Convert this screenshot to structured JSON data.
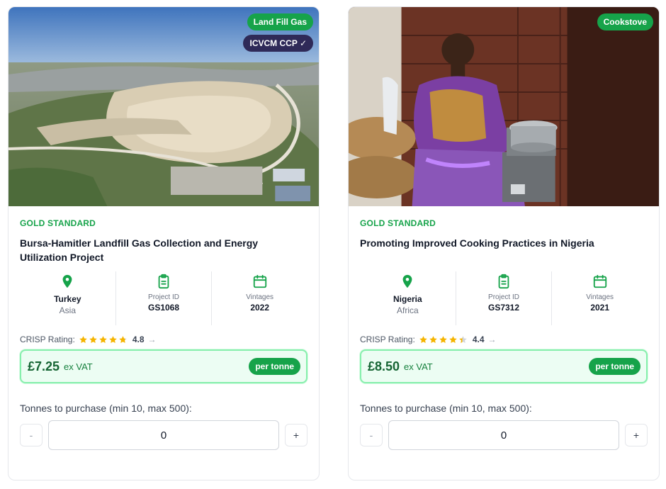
{
  "projects": [
    {
      "tags": [
        "Land Fill Gas",
        "ICVCM CCP ✓"
      ],
      "standard": "GOLD STANDARD",
      "title": "Bursa-Hamitler Landfill Gas Collection and Energy Utilization Project",
      "country": "Turkey",
      "region": "Asia",
      "project_id_label": "Project ID",
      "project_id": "GS1068",
      "vintages_label": "Vintages",
      "vintages": "2022",
      "rating_label": "CRISP Rating:",
      "rating_value": "4.8",
      "stars": 4.8,
      "rating_arrow": "→",
      "price": "£7.25",
      "vat": "ex VAT",
      "unit": "per tonne",
      "qty_label": "Tonnes to purchase (min 10, max 500):",
      "qty_value": "0",
      "minus": "-",
      "plus": "+"
    },
    {
      "tags": [
        "Cookstove"
      ],
      "standard": "GOLD STANDARD",
      "title": "Promoting Improved Cooking Practices in Nigeria",
      "country": "Nigeria",
      "region": "Africa",
      "project_id_label": "Project ID",
      "project_id": "GS7312",
      "vintages_label": "Vintages",
      "vintages": "2021",
      "rating_label": "CRISP Rating:",
      "rating_value": "4.4",
      "stars": 4.4,
      "rating_arrow": "→",
      "price": "£8.50",
      "vat": "ex VAT",
      "unit": "per tonne",
      "qty_label": "Tonnes to purchase (min 10, max 500):",
      "qty_value": "0",
      "minus": "-",
      "plus": "+"
    }
  ],
  "colors": {
    "accent": "#16a34a",
    "star": "#f5b400",
    "navy_tag": "#2f2a58",
    "price_bg": "#ecfdf3"
  }
}
